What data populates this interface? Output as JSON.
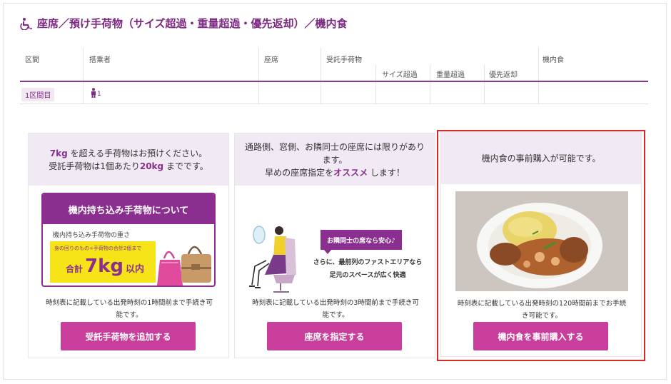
{
  "page": {
    "title": "座席／預け手荷物（サイズ超過・重量超過・優先返却）／機内食"
  },
  "table": {
    "headers": {
      "segment": "区間",
      "passenger": "搭乗者",
      "seat": "座席",
      "checked_baggage": "受託手荷物",
      "size_over": "サイズ超過",
      "weight_over": "重量超過",
      "priority_return": "優先返却",
      "meal": "機内食"
    },
    "row": {
      "segment_label": "1区間目",
      "passenger_count": "1"
    }
  },
  "cards": {
    "baggage": {
      "head": {
        "kg7": "7kg",
        "line1_rest": " を超える手荷物はお預けください。",
        "line2_pre": "受託手荷物は1個あたり",
        "kg20": "20kg",
        "line2_post": " までです。"
      },
      "panel": {
        "title": "機内持ち込み手荷物について",
        "subtitle": "機内持ち込み手荷物の重さ",
        "small": "身の回りのもの+手荷物の合計2個まで",
        "total_label": "合計",
        "total_value": "7kg",
        "total_suffix": "以内"
      },
      "note_line1": "時刻表に記載している出発時刻の1時間前まで手続き可",
      "note_line2": "能です。",
      "button": "受託手荷物を追加する"
    },
    "seat": {
      "head": {
        "line1": "通路側、窓側、お隣同士の座席には限りがあり",
        "line2": "ます。",
        "line3_pre": "早めの座席指定を",
        "line3_hl": "オススメ",
        "line3_post": " します！"
      },
      "bubble": "お隣同士の席なら安心♪",
      "bubble_text_line1": "さらに、最前列のファストエリアなら",
      "bubble_text_line2": "足元のスペースが広く快適",
      "note_line1": "時刻表に記載している出発時刻の3時間前まで手続き可",
      "note_line2": "能です。",
      "button": "座席を指定する"
    },
    "meal": {
      "head": "機内食の事前購入が可能です。",
      "note_line1": "時刻表に記載している出発時刻の120時間前までお手続",
      "note_line2": "き可能です。",
      "button": "機内食を事前購入する"
    }
  },
  "colors": {
    "brand_purple": "#8a2f8f",
    "button_pink": "#c93e9a",
    "highlight_red": "#d42a2a",
    "card_head_bg": "#f1e9f4",
    "badge_yellow": "#f6e418"
  }
}
